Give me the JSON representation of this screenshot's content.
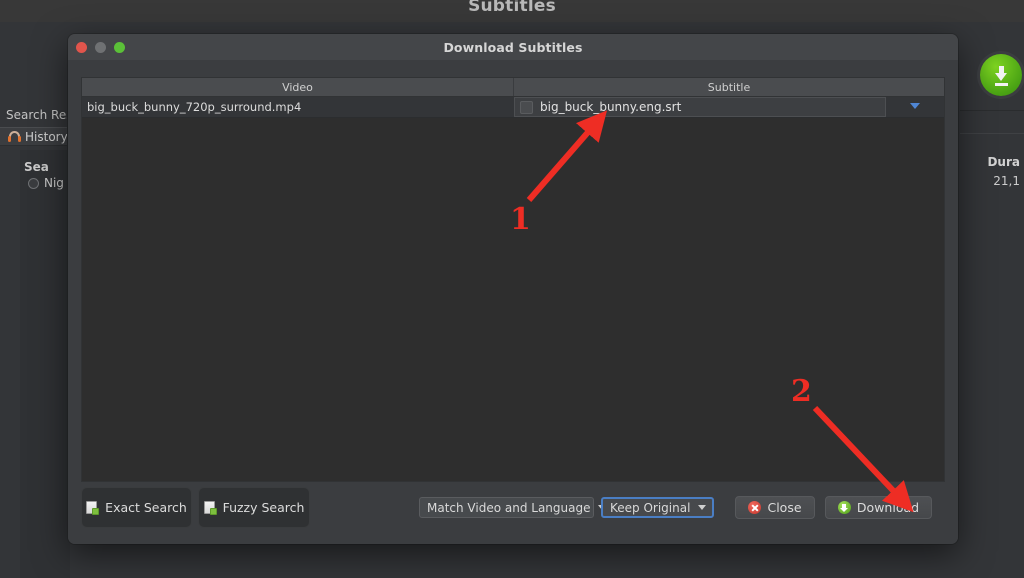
{
  "background_app": {
    "title": "Subtitles",
    "left_panel": {
      "search_results_label": "Search Resu",
      "history_label": "History",
      "history_icon": "headphone-icon",
      "search_sublabel": "Sea",
      "night_label": "Nig"
    },
    "right_panel": {
      "download_badge_icon": "green-download-circle-icon",
      "duration_label": "Dura",
      "duration_value": "21,1"
    }
  },
  "dialog": {
    "title": "Download Subtitles",
    "window_controls": {
      "close": "close-traffic-light",
      "minimize": "minimize-traffic-light",
      "maximize": "maximize-traffic-light"
    },
    "table": {
      "columns": [
        "Video",
        "Subtitle"
      ],
      "rows": [
        {
          "video": "big_buck_bunny_720p_surround.mp4",
          "subtitle": "big_buck_bunny.eng.srt",
          "subtitle_dropdown_icon": "chevron-down-icon"
        }
      ]
    },
    "buttons": {
      "exact_search": "Exact Search",
      "fuzzy_search": "Fuzzy Search",
      "close": "Close",
      "download": "Download",
      "search_icon": "document-search-icon",
      "close_icon": "red-x-circle-icon",
      "download_icon": "green-download-circle-icon"
    },
    "selects": {
      "match_mode": "Match Video and Language",
      "keep_mode": "Keep Original",
      "caret_icon": "caret-down-icon"
    }
  },
  "annotations": {
    "marker_1": "1",
    "marker_2": "2",
    "arrow_color": "#ee2d24"
  }
}
